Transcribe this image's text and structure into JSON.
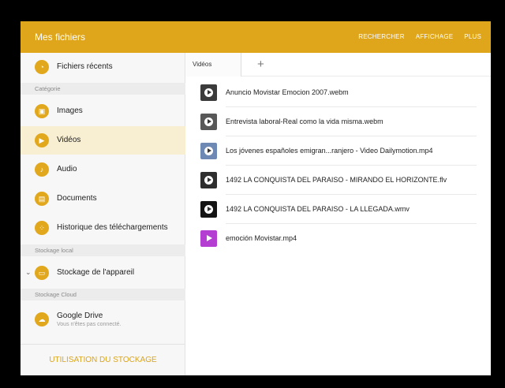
{
  "appbar": {
    "title": "Mes fichiers",
    "actions": [
      "RECHERCHER",
      "AFFICHAGE",
      "PLUS"
    ]
  },
  "sidebar": {
    "recent": "Fichiers récents",
    "category_header": "Catégorie",
    "categories": [
      {
        "label": "Images",
        "icon": "image-icon"
      },
      {
        "label": "Vidéos",
        "icon": "video-icon"
      },
      {
        "label": "Audio",
        "icon": "music-note-icon"
      },
      {
        "label": "Documents",
        "icon": "document-icon"
      },
      {
        "label": "Historique des téléchargements",
        "icon": "download-history-icon"
      }
    ],
    "local_header": "Stockage local",
    "device_storage": "Stockage de l'appareil",
    "cloud_header": "Stockage Cloud",
    "google_drive": {
      "label": "Google Drive",
      "sub": "Vous n'êtes pas connecté."
    },
    "storage_usage": "UTILISATION DU STOCKAGE"
  },
  "tabs": {
    "active": "Vidéos",
    "add": "+"
  },
  "files": [
    "Anuncio Movistar Emocion 2007.webm",
    "Entrevista laboral-Real como la vida misma.webm",
    "Los jóvenes españoles emigran...ranjero - Video Dailymotion.mp4",
    "1492 LA CONQUISTA DEL PARAISO - MIRANDO EL HORIZONTE.flv",
    "1492 LA CONQUISTA DEL PARAISO - LA LLEGADA.wmv",
    "emoción Movistar.mp4"
  ],
  "colors": {
    "accent": "#dfa51b",
    "active_bg": "#f8eed2"
  }
}
